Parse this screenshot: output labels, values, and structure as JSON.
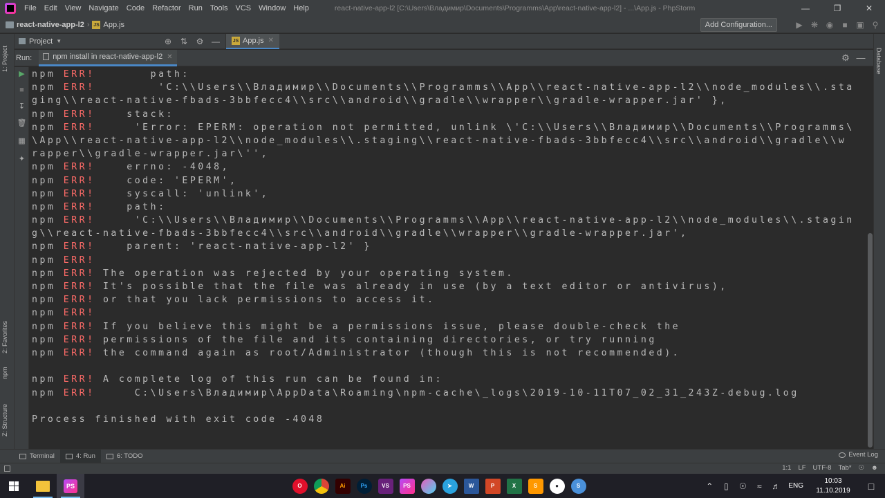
{
  "titlebar": {
    "menu": [
      "File",
      "Edit",
      "View",
      "Navigate",
      "Code",
      "Refactor",
      "Run",
      "Tools",
      "VCS",
      "Window",
      "Help"
    ],
    "window_title": "react-native-app-l2 [C:\\Users\\Владимир\\Documents\\Programms\\App\\react-native-app-l2] - ...\\App.js - PhpStorm"
  },
  "navbar": {
    "project": "react-native-app-l2",
    "file": "App.js",
    "add_configuration": "Add Configuration..."
  },
  "project_panel": {
    "label": "Project"
  },
  "editor_tab": {
    "label": "App.js"
  },
  "run_window": {
    "label": "Run:",
    "tab_label": "npm install in react-native-app-l2"
  },
  "left_stripe": {
    "project": "1: Project",
    "favorites": "2: Favorites",
    "npm": "npm",
    "structure": "Z: Structure"
  },
  "right_stripe": {
    "database": "Database"
  },
  "console": {
    "prefix": "npm",
    "err": "ERR!",
    "lines": [
      {
        "npm": true,
        "text": "       path:"
      },
      {
        "npm": true,
        "text": "        'C:\\\\Users\\\\Владимир\\\\Documents\\\\Programms\\\\App\\\\react-native-app-l2\\\\node_modules\\\\.sta"
      },
      {
        "npm": false,
        "text": "ging\\\\react-native-fbads-3bbfecc4\\\\src\\\\android\\\\gradle\\\\wrapper\\\\gradle-wrapper.jar' },"
      },
      {
        "npm": true,
        "text": "    stack:"
      },
      {
        "npm": true,
        "text": "     'Error: EPERM: operation not permitted, unlink \\'C:\\\\Users\\\\Владимир\\\\Documents\\\\Programms\\"
      },
      {
        "npm": false,
        "text": "\\App\\\\react-native-app-l2\\\\node_modules\\\\.staging\\\\react-native-fbads-3bbfecc4\\\\src\\\\android\\\\gradle\\\\w"
      },
      {
        "npm": false,
        "text": "rapper\\\\gradle-wrapper.jar\\'',"
      },
      {
        "npm": true,
        "text": "    errno: -4048,"
      },
      {
        "npm": true,
        "text": "    code: 'EPERM',"
      },
      {
        "npm": true,
        "text": "    syscall: 'unlink',"
      },
      {
        "npm": true,
        "text": "    path:"
      },
      {
        "npm": true,
        "text": "     'C:\\\\Users\\\\Владимир\\\\Documents\\\\Programms\\\\App\\\\react-native-app-l2\\\\node_modules\\\\.stagin"
      },
      {
        "npm": false,
        "text": "g\\\\react-native-fbads-3bbfecc4\\\\src\\\\android\\\\gradle\\\\wrapper\\\\gradle-wrapper.jar',"
      },
      {
        "npm": true,
        "text": "    parent: 'react-native-app-l2' }"
      },
      {
        "npm": true,
        "text": ""
      },
      {
        "npm": true,
        "text": " The operation was rejected by your operating system."
      },
      {
        "npm": true,
        "text": " It's possible that the file was already in use (by a text editor or antivirus),"
      },
      {
        "npm": true,
        "text": " or that you lack permissions to access it."
      },
      {
        "npm": true,
        "text": ""
      },
      {
        "npm": true,
        "text": " If you believe this might be a permissions issue, please double-check the"
      },
      {
        "npm": true,
        "text": " permissions of the file and its containing directories, or try running"
      },
      {
        "npm": true,
        "text": " the command again as root/Administrator (though this is not recommended)."
      },
      {
        "npm": false,
        "text": ""
      },
      {
        "npm": true,
        "text": " A complete log of this run can be found in:"
      },
      {
        "npm": true,
        "text": "     C:\\Users\\Владимир\\AppData\\Roaming\\npm-cache\\_logs\\2019-10-11T07_02_31_243Z-debug.log"
      },
      {
        "npm": false,
        "text": ""
      },
      {
        "npm": false,
        "text": "Process finished with exit code -4048"
      }
    ]
  },
  "bottombar": {
    "terminal": "Terminal",
    "run": "4: Run",
    "todo": "6: TODO",
    "event_log": "Event Log"
  },
  "statusbar": {
    "position": "1:1",
    "line_sep": "LF",
    "encoding": "UTF-8",
    "indent": "Tab*"
  },
  "taskbar": {
    "lang": "ENG",
    "time": "10:03",
    "date": "11.10.2019"
  }
}
